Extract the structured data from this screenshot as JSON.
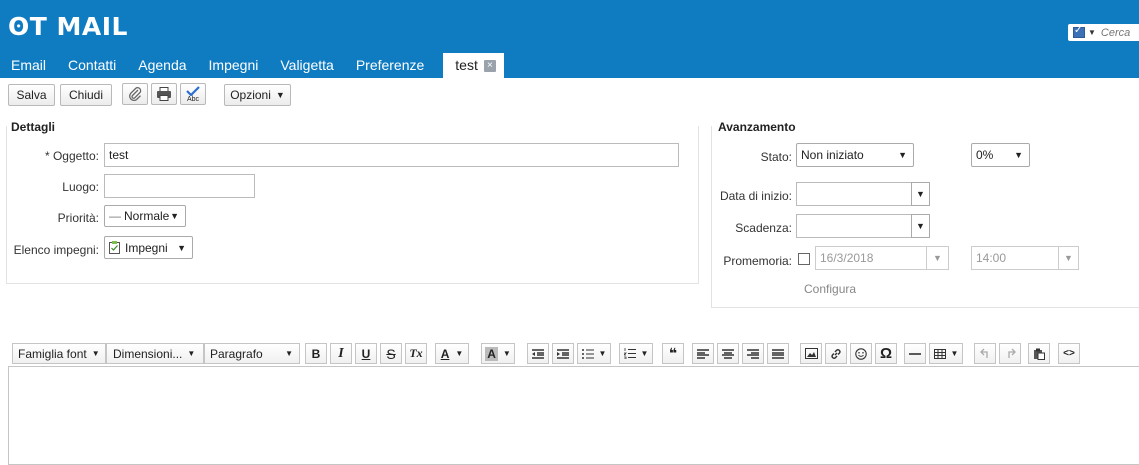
{
  "app": {
    "logo": "ʘT MAIL"
  },
  "tabs": [
    {
      "label": "Email"
    },
    {
      "label": "Contatti"
    },
    {
      "label": "Agenda"
    },
    {
      "label": "Impegni"
    },
    {
      "label": "Valigetta"
    },
    {
      "label": "Preferenze"
    }
  ],
  "active_tab": {
    "label": "test",
    "close": "×"
  },
  "search": {
    "placeholder": "Cerca",
    "caret": "▼"
  },
  "toolbar": {
    "save": "Salva",
    "close": "Chiudi",
    "attach_icon": "paperclip-icon",
    "print_icon": "printer-icon",
    "spell_icon": "spellcheck-icon",
    "spell_text": "Abc",
    "options": "Opzioni",
    "caret": "▼"
  },
  "details": {
    "title": "Dettagli",
    "subject_label": "* Oggetto:",
    "subject_value": "test",
    "location_label": "Luogo:",
    "location_value": "",
    "priority_label": "Priorità:",
    "priority_value": "Normale",
    "priority_prefix": "—",
    "list_label": "Elenco impegni:",
    "list_value": "Impegni"
  },
  "progress": {
    "title": "Avanzamento",
    "status_label": "Stato:",
    "status_value": "Non iniziato",
    "percent_value": "0%",
    "start_label": "Data di inizio:",
    "start_value": "",
    "due_label": "Scadenza:",
    "due_value": "",
    "reminder_label": "Promemoria:",
    "reminder_checked": false,
    "reminder_date": "16/3/2018",
    "reminder_time": "14:00",
    "configure": "Configura"
  },
  "editor": {
    "font_family": "Famiglia font",
    "font_size": "Dimensioni...",
    "paragraph": "Paragrafo",
    "bold": "B",
    "italic": "I",
    "underline": "U",
    "strike": "S",
    "clear": "Tx",
    "text_color": "A",
    "bg_color": "A",
    "blockquote": "❝",
    "omega": "Ω",
    "code": "<>",
    "caret": "▼"
  },
  "colors": {
    "header_bg": "#0f7bc1",
    "accent": "#0f7bc1"
  }
}
